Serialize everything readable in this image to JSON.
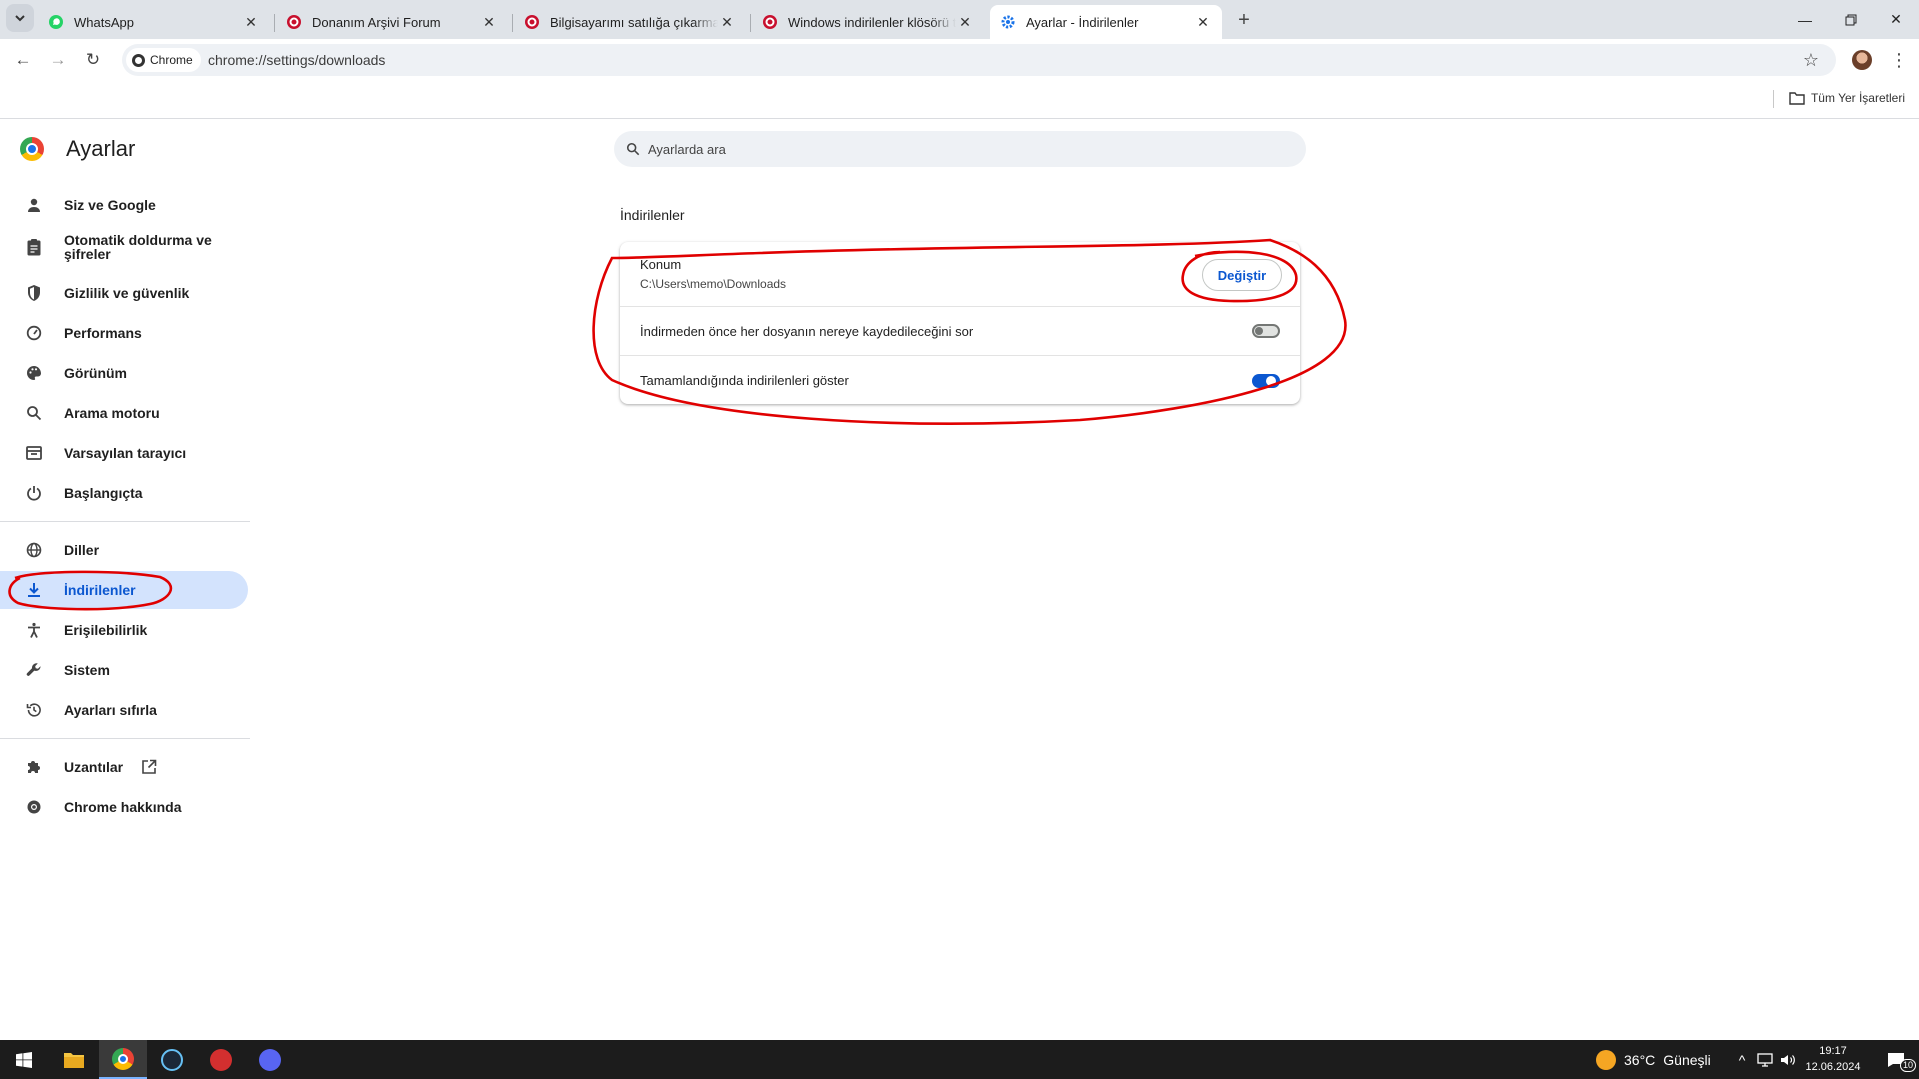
{
  "tabs": [
    {
      "title": "WhatsApp",
      "favicon": "whatsapp-icon"
    },
    {
      "title": "Donanım Arşivi Forum",
      "favicon": "donanimarsivi-icon"
    },
    {
      "title": "Bilgisayarımı satılığa çıkarmak i",
      "favicon": "donanimarsivi-icon"
    },
    {
      "title": "Windows indirilenler klösörü ta",
      "favicon": "donanimarsivi-icon"
    },
    {
      "title": "Ayarlar - İndirilenler",
      "favicon": "gear-icon"
    }
  ],
  "toolbar": {
    "chip_label": "Chrome",
    "url": "chrome://settings/downloads"
  },
  "bookmarks": {
    "all_bookmarks": "Tüm Yer İşaretleri"
  },
  "sidebar": {
    "title": "Ayarlar",
    "items": [
      {
        "label": "Siz ve Google",
        "icon": "person-icon"
      },
      {
        "label": "Otomatik doldurma ve şifreler",
        "icon": "clipboard-icon"
      },
      {
        "label": "Gizlilik ve güvenlik",
        "icon": "shield-icon"
      },
      {
        "label": "Performans",
        "icon": "speedometer-icon"
      },
      {
        "label": "Görünüm",
        "icon": "palette-icon"
      },
      {
        "label": "Arama motoru",
        "icon": "search-icon"
      },
      {
        "label": "Varsayılan tarayıcı",
        "icon": "browser-icon"
      },
      {
        "label": "Başlangıçta",
        "icon": "power-icon"
      },
      {
        "label": "Diller",
        "icon": "globe-icon"
      },
      {
        "label": "İndirilenler",
        "icon": "download-icon",
        "selected": true
      },
      {
        "label": "Erişilebilirlik",
        "icon": "accessibility-icon"
      },
      {
        "label": "Sistem",
        "icon": "wrench-icon"
      },
      {
        "label": "Ayarları sıfırla",
        "icon": "history-icon"
      },
      {
        "label": "Uzantılar",
        "icon": "puzzle-icon"
      },
      {
        "label": "Chrome hakkında",
        "icon": "chrome-icon"
      }
    ]
  },
  "search": {
    "placeholder": "Ayarlarda ara"
  },
  "downloads": {
    "section_title": "İndirilenler",
    "location_label": "Konum",
    "location_path": "C:\\Users\\memo\\Downloads",
    "change_button": "Değiştir",
    "ask_where_label": "İndirmeden önce her dosyanın nereye kaydedileceğini sor",
    "ask_where_enabled": false,
    "show_when_done_label": "Tamamlandığında indirilenleri göster",
    "show_when_done_enabled": true
  },
  "taskbar": {
    "weather_temp": "36°C",
    "weather_desc": "Güneşli",
    "time": "19:17",
    "date": "12.06.2024",
    "notifications": "10"
  },
  "colors": {
    "accent": "#0b57d0",
    "selected_bg": "#d3e3fd",
    "annotation": "#e00000",
    "tabstrip": "#dfe3e8"
  }
}
